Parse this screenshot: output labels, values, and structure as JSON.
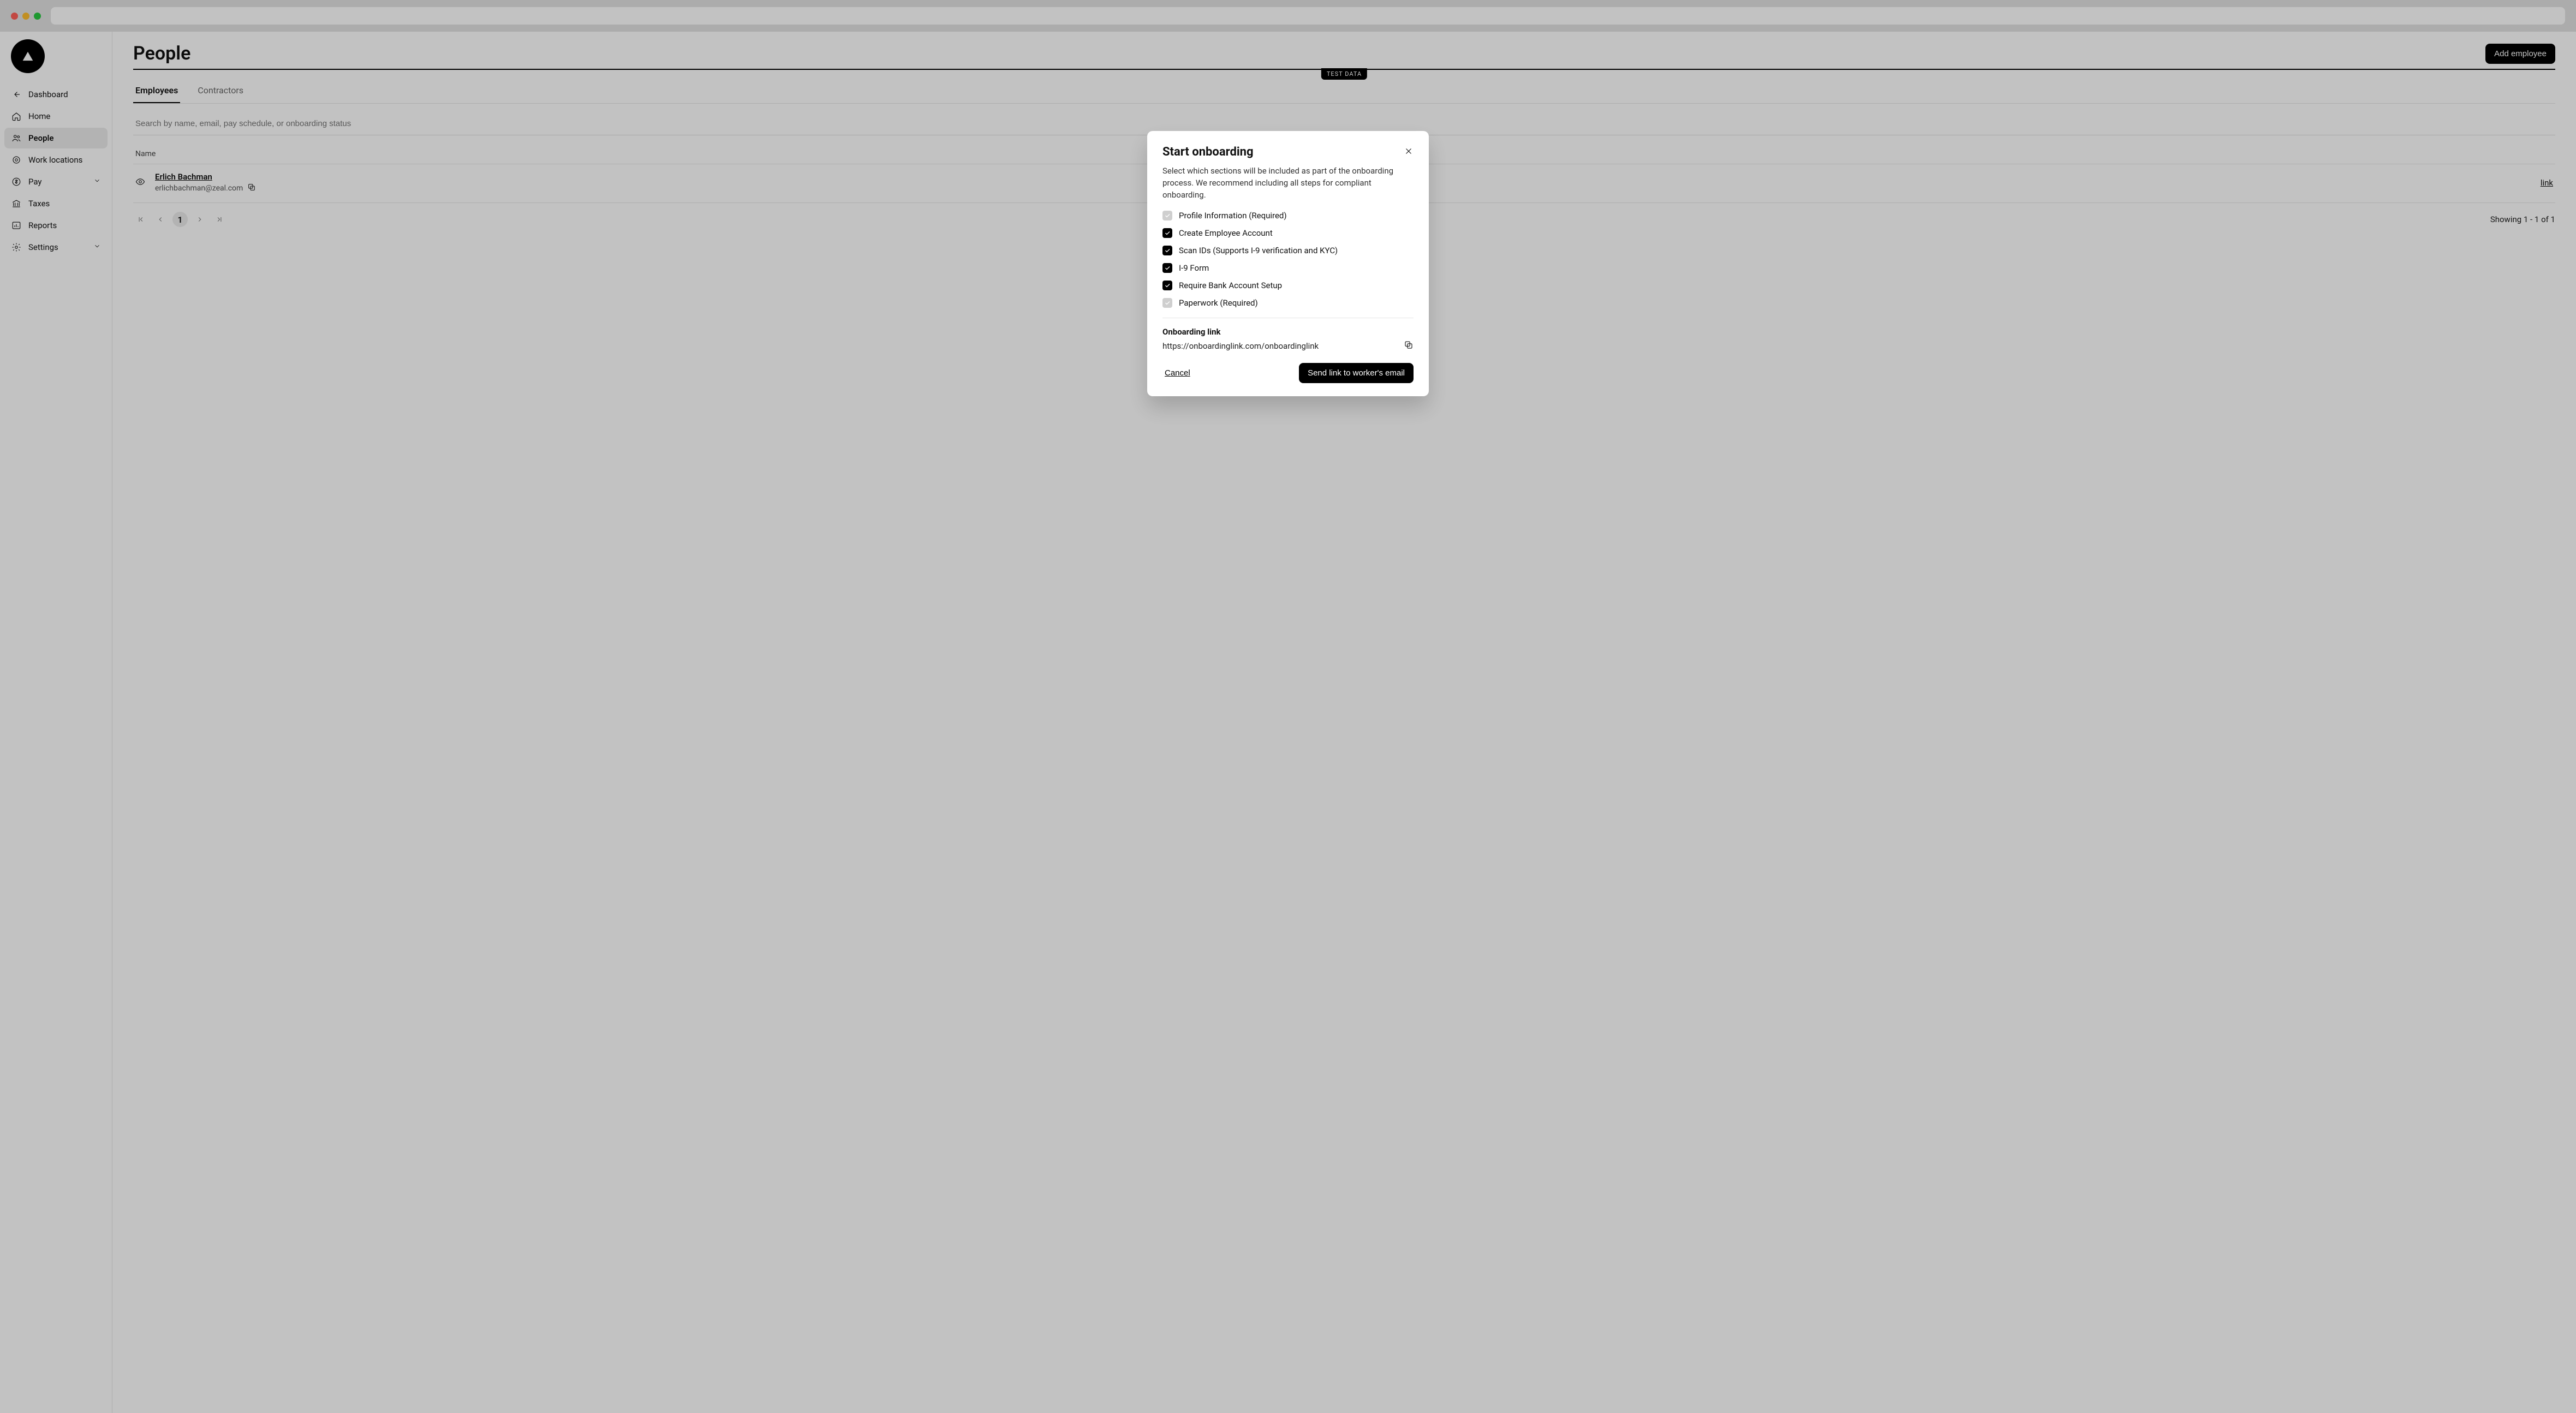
{
  "sidebar": {
    "items": [
      {
        "label": "Dashboard"
      },
      {
        "label": "Home"
      },
      {
        "label": "People"
      },
      {
        "label": "Work locations"
      },
      {
        "label": "Pay"
      },
      {
        "label": "Taxes"
      },
      {
        "label": "Reports"
      },
      {
        "label": "Settings"
      }
    ]
  },
  "page": {
    "title": "People",
    "add_button": "Add employee",
    "test_badge": "TEST DATA"
  },
  "tabs": {
    "employees": "Employees",
    "contractors": "Contractors"
  },
  "search": {
    "placeholder": "Search by name, email, pay schedule, or onboarding status"
  },
  "table": {
    "columns": {
      "name": "Name"
    },
    "rows": [
      {
        "name": "Erlich Bachman",
        "email": "erlichbachman@zeal.com",
        "action_link": "link"
      }
    ]
  },
  "pager": {
    "current": "1",
    "info": "Showing 1 - 1 of 1"
  },
  "modal": {
    "title": "Start onboarding",
    "description": "Select which sections will be included as part of the onboarding process. We recommend including all steps for compliant onboarding.",
    "checks": [
      {
        "label": "Profile Information (Required)",
        "state": "disabled"
      },
      {
        "label": "Create Employee Account",
        "state": "checked"
      },
      {
        "label": "Scan IDs (Supports I-9 verification and KYC)",
        "state": "checked"
      },
      {
        "label": "I-9 Form",
        "state": "checked"
      },
      {
        "label": "Require Bank Account Setup",
        "state": "checked"
      },
      {
        "label": "Paperwork (Required)",
        "state": "disabled"
      }
    ],
    "link_label": "Onboarding link",
    "link_url": "https://onboardinglink.com/onboardinglink",
    "cancel": "Cancel",
    "submit": "Send link to worker's email"
  }
}
